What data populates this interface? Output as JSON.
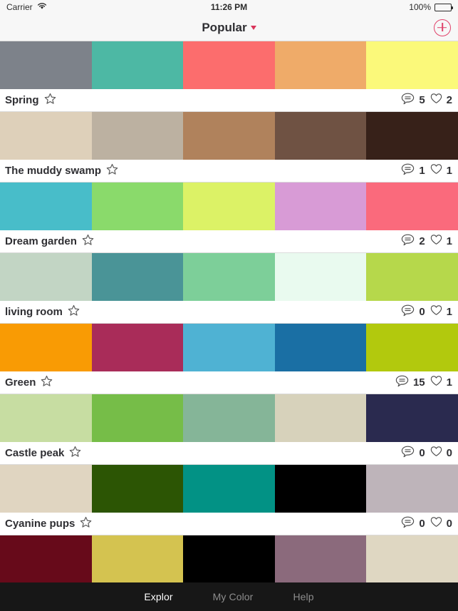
{
  "status_bar": {
    "carrier": "Carrier",
    "wifi_icon": "wifi-icon",
    "time": "11:26 PM",
    "battery_percent": "100%",
    "battery_icon": "battery-full-icon"
  },
  "nav_bar": {
    "title": "Popular",
    "caret_icon": "chevron-down-icon",
    "add_icon": "plus-circle-icon",
    "accent_color": "#e0416a"
  },
  "palettes": [
    {
      "name": "Spring",
      "favorite_icon": "star-outline-icon",
      "comment_icon": "comment-icon",
      "comments": "5",
      "heart_icon": "heart-outline-icon",
      "likes": "2",
      "colors": [
        "#7d828a",
        "#4db8a4",
        "#fc6d6d",
        "#efab69",
        "#fbf97a"
      ]
    },
    {
      "name": "The muddy swamp",
      "favorite_icon": "star-outline-icon",
      "comment_icon": "comment-icon",
      "comments": "1",
      "heart_icon": "heart-outline-icon",
      "likes": "1",
      "colors": [
        "#ded0ba",
        "#bcb1a1",
        "#b0825c",
        "#6f5243",
        "#372119"
      ]
    },
    {
      "name": "Dream garden",
      "favorite_icon": "star-outline-icon",
      "comment_icon": "comment-icon",
      "comments": "2",
      "heart_icon": "heart-outline-icon",
      "likes": "1",
      "colors": [
        "#48bdc9",
        "#8ada6b",
        "#dcf266",
        "#d89bd6",
        "#fa6a7c"
      ]
    },
    {
      "name": "living room",
      "favorite_icon": "star-outline-icon",
      "comment_icon": "comment-icon",
      "comments": "0",
      "heart_icon": "heart-outline-icon",
      "likes": "1",
      "colors": [
        "#c2d5c4",
        "#4a9497",
        "#7dcf99",
        "#e9faef",
        "#b6d84b"
      ]
    },
    {
      "name": "Green",
      "favorite_icon": "star-outline-icon",
      "comment_icon": "comment-icon",
      "comments": "15",
      "heart_icon": "heart-outline-icon",
      "likes": "1",
      "colors": [
        "#f99b04",
        "#a92c59",
        "#4fb2d3",
        "#1a6fa4",
        "#b2c90d"
      ]
    },
    {
      "name": "Castle peak",
      "favorite_icon": "star-outline-icon",
      "comment_icon": "comment-icon",
      "comments": "0",
      "heart_icon": "heart-outline-icon",
      "likes": "0",
      "colors": [
        "#c7dda2",
        "#76bd48",
        "#85b598",
        "#d7d2bb",
        "#2a2a4f"
      ]
    },
    {
      "name": "Cyanine pups",
      "favorite_icon": "star-outline-icon",
      "comment_icon": "comment-icon",
      "comments": "0",
      "heart_icon": "heart-outline-icon",
      "likes": "0",
      "colors": [
        "#e0d5c1",
        "#2c5504",
        "#029285",
        "#000000",
        "#beb4ba"
      ]
    },
    {
      "name": "",
      "favorite_icon": "star-outline-icon",
      "comment_icon": "comment-icon",
      "comments": "",
      "heart_icon": "heart-outline-icon",
      "likes": "",
      "colors": [
        "#670a1a",
        "#d4c350",
        "#000000",
        "#8b6a7c",
        "#dfd7c2"
      ]
    }
  ],
  "tab_bar": {
    "tabs": [
      {
        "label": "Explor",
        "active": true
      },
      {
        "label": "My Color",
        "active": false
      },
      {
        "label": "Help",
        "active": false
      }
    ]
  }
}
